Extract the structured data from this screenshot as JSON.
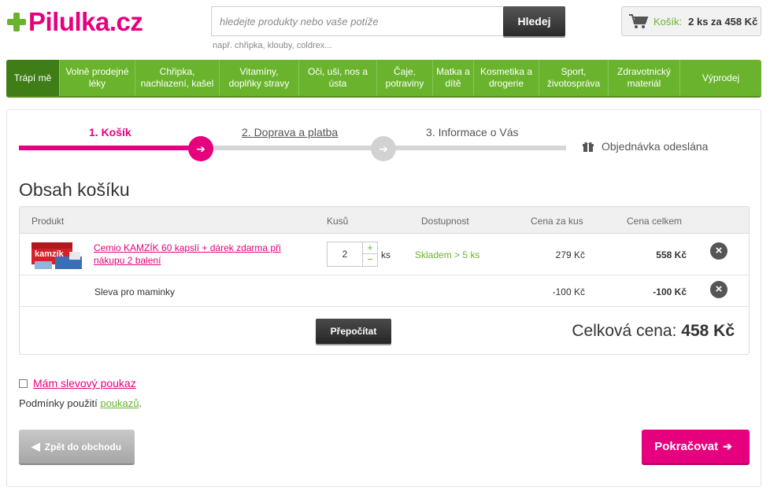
{
  "header": {
    "logo_text": "Pilulka.cz",
    "search_placeholder": "hledejte produkty nebo vaše potíže",
    "search_button": "Hledej",
    "search_hint": "např. chřipka, klouby, coldrex...",
    "cart_label": "Košík:",
    "cart_summary": "2 ks za 458 Kč"
  },
  "nav": {
    "items": [
      {
        "label": "Trápí mě"
      },
      {
        "label": "Volně prodejné léky"
      },
      {
        "label": "Chřipka, nachlazení, kašel"
      },
      {
        "label": "Vitamíny, doplňky stravy"
      },
      {
        "label": "Oči, uši, nos a ústa"
      },
      {
        "label": "Čaje, potraviny"
      },
      {
        "label": "Matka a dítě"
      },
      {
        "label": "Kosmetika a drogerie"
      },
      {
        "label": "Sport, životospráva"
      },
      {
        "label": "Zdravotnický materiál"
      },
      {
        "label": "Výprodej"
      }
    ]
  },
  "steps": {
    "step1": "1. Košík",
    "step2": "2. Doprava a platba",
    "step3": "3. Informace o Vás",
    "step4": "Objednávka odeslána"
  },
  "cart": {
    "title": "Obsah košíku",
    "columns": {
      "product": "Produkt",
      "qty": "Kusů",
      "availability": "Dostupnost",
      "unit_price": "Cena za kus",
      "total_price": "Cena celkem"
    },
    "items": [
      {
        "name": "Cemio KAMZÍK 60 kapslí + dárek zdarma při nákupu 2 balení",
        "qty": "2",
        "unit": "ks",
        "availability": "Skladem > 5 ks",
        "unit_price": "279 Kč",
        "total_price": "558 Kč",
        "thumb_text": "kamzík"
      }
    ],
    "discount": {
      "name": "Sleva pro maminky",
      "unit_price": "-100 Kč",
      "total_price": "-100 Kč"
    },
    "recalc_button": "Přepočítat",
    "grand_total_label": "Celková cena:",
    "grand_total_value": "458 Kč"
  },
  "voucher": {
    "checkbox_label": "Mám slevový poukaz",
    "conditions_prefix": "Podmínky použití",
    "conditions_link": "poukazů",
    "conditions_suffix": "."
  },
  "actions": {
    "back": "Zpět do obchodu",
    "continue": "Pokračovat"
  },
  "colors": {
    "brand_pink": "#e6007e",
    "brand_green": "#6ab42d"
  }
}
